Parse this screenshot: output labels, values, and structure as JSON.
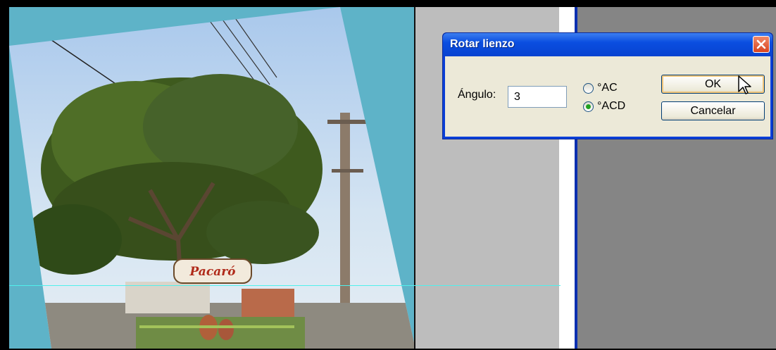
{
  "dialog": {
    "title": "Rotar lienzo",
    "angle_label": "Ángulo:",
    "angle_value": "3",
    "radio_ac_label": "°AC",
    "radio_acd_label": "°ACD",
    "selected_direction": "°ACD",
    "ok_label": "OK",
    "cancel_label": "Cancelar"
  },
  "canvas": {
    "sign_text": "Pacaró",
    "background_color": "#5eb3c8"
  },
  "colors": {
    "titlebar": "#0a4ee0",
    "dialog_face": "#ece9d8",
    "guide_line": "#4ff0ec",
    "close_button": "#d9431f"
  },
  "icons": {
    "close": "close-icon",
    "cursor": "mouse-pointer-icon"
  }
}
